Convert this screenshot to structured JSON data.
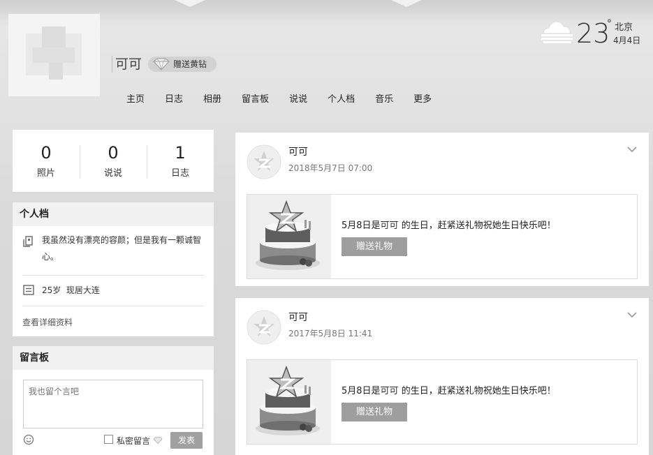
{
  "header": {
    "nickname": "可可",
    "vip_gift_label": "赠送黄钻",
    "nav": [
      "主页",
      "日志",
      "相册",
      "留言板",
      "说说",
      "个人档",
      "音乐",
      "更多"
    ]
  },
  "weather": {
    "icon": "cloudy-icon",
    "temperature": "23",
    "degree_symbol": "°",
    "city": "北京",
    "date": "4月4日"
  },
  "stats": [
    {
      "value": "0",
      "label": "照片"
    },
    {
      "value": "0",
      "label": "说说"
    },
    {
      "value": "1",
      "label": "日志"
    }
  ],
  "profile": {
    "title": "个人档",
    "bio": "我虽然没有漂亮的容颜；但是我有一颗诚智心。",
    "info": "25岁  现居大连",
    "more_link": "查看详细资料"
  },
  "guestbook": {
    "title": "留言板",
    "placeholder": "我也留个言吧",
    "private_label": "私密留言",
    "send_label": "发表"
  },
  "feed": [
    {
      "name": "可可",
      "time": "2018年5月7日 07:00",
      "message_prefix": "5月8日是",
      "message_name": "可可",
      "message_suffix": " 的生日，赶紧送礼物祝她生日快乐吧！",
      "button": "赠送礼物"
    },
    {
      "name": "可可",
      "time": "2017年5月8日 11:41",
      "message_prefix": "5月8日是",
      "message_name": "可可",
      "message_suffix": " 的生日，赶紧送礼物祝她生日快乐吧！",
      "button": "赠送礼物"
    }
  ]
}
